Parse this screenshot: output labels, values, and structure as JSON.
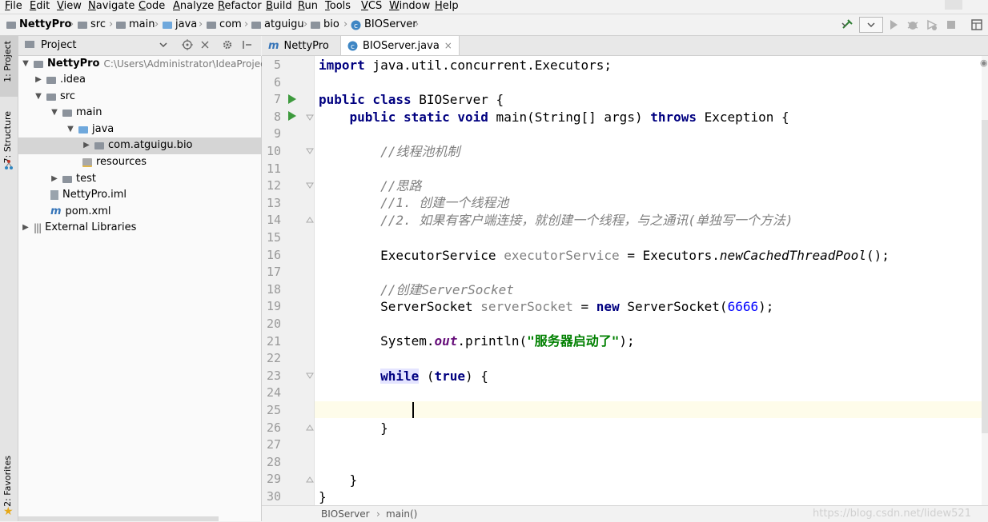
{
  "menu": [
    "File",
    "Edit",
    "View",
    "Navigate",
    "Code",
    "Analyze",
    "Refactor",
    "Build",
    "Run",
    "Tools",
    "VCS",
    "Window",
    "Help"
  ],
  "breadcrumbs": [
    "NettyPro",
    "src",
    "main",
    "java",
    "com",
    "atguigu",
    "bio",
    "BIOServer"
  ],
  "left_strip": {
    "project_tab": "1: Project",
    "structure_tab": "7: Structure",
    "favorites_tab": "2: Favorites"
  },
  "project_panel": {
    "title": "Project",
    "tree": [
      {
        "label": "NettyPro",
        "path": "C:\\Users\\Administrator\\IdeaProject"
      },
      {
        "label": ".idea"
      },
      {
        "label": "src"
      },
      {
        "label": "main"
      },
      {
        "label": "java"
      },
      {
        "label": "com.atguigu.bio"
      },
      {
        "label": "resources"
      },
      {
        "label": "test"
      },
      {
        "label": "NettyPro.iml"
      },
      {
        "label": "pom.xml"
      },
      {
        "label": "External Libraries"
      }
    ]
  },
  "editor": {
    "tabs": [
      {
        "label": "NettyPro",
        "icon": "maven-m-icon"
      },
      {
        "label": "BIOServer.java",
        "icon": "java-class-icon"
      }
    ],
    "line_numbers": [
      "5",
      "6",
      "7",
      "8",
      "9",
      "10",
      "11",
      "12",
      "13",
      "14",
      "15",
      "16",
      "17",
      "18",
      "19",
      "20",
      "21",
      "22",
      "23",
      "24",
      "25",
      "26",
      "27",
      "28",
      "29",
      "30"
    ],
    "code": {
      "l5_kw": "import",
      "l5_rest": " java.util.concurrent.Executors;",
      "l7_kw": "public class",
      "l7_rest": " BIOServer {",
      "l8_kw1": "public static void",
      "l8_mid": " main(String[] args) ",
      "l8_kw2": "throws",
      "l8_rest": " Exception {",
      "l10": "//线程池机制",
      "l12": "//思路",
      "l13": "//1. 创建一个线程池",
      "l14": "//2. 如果有客户端连接，就创建一个线程，与之通讯(单独写一个方法)",
      "l16_a": "ExecutorService ",
      "l16_var": "executorService",
      "l16_b": " = Executors.",
      "l16_it": "newCachedThreadPool",
      "l16_c": "();",
      "l18": "//创建ServerSocket",
      "l19_a": "ServerSocket ",
      "l19_var": "serverSocket",
      "l19_b": " = ",
      "l19_kw": "new",
      "l19_c": " ServerSocket(",
      "l19_num": "6666",
      "l19_d": ");",
      "l21_a": "System.",
      "l21_fld": "out",
      "l21_b": ".println(",
      "l21_str": "\"服务器启动了\"",
      "l21_c": ");",
      "l23_kw1": "while",
      "l23_a": " (",
      "l23_kw2": "true",
      "l23_b": ") {",
      "l26": "}",
      "l29": "}",
      "l30": "}"
    }
  },
  "status": {
    "crumb1": "BIOServer",
    "crumb2": "main()"
  },
  "watermark": "https://blog.csdn.net/lidew521",
  "colors": {
    "keyword": "#000080",
    "comment": "#808080",
    "string": "#008000",
    "number": "#0000ff",
    "field": "#660e7a",
    "current_line": "#fefcea",
    "run_green": "#3d9a3d"
  }
}
